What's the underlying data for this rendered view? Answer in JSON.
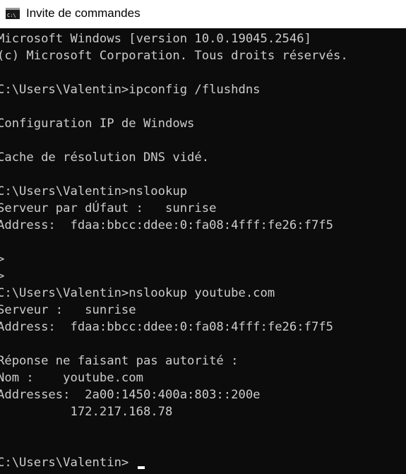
{
  "window": {
    "title": "Invite de commandes",
    "icon": "cmd-icon",
    "icon_label": "C:\\"
  },
  "console": {
    "lines": [
      "Microsoft Windows [version 10.0.19045.2546]",
      "(c) Microsoft Corporation. Tous droits réservés.",
      "",
      "C:\\Users\\Valentin>ipconfig /flushdns",
      "",
      "Configuration IP de Windows",
      "",
      "Cache de résolution DNS vidé.",
      "",
      "C:\\Users\\Valentin>nslookup",
      "Serveur par dÚfaut :   sunrise",
      "Address:  fdaa:bbcc:ddee:0:fa08:4fff:fe26:f7f5",
      "",
      ">",
      ">",
      "C:\\Users\\Valentin>nslookup youtube.com",
      "Serveur :   sunrise",
      "Address:  fdaa:bbcc:ddee:0:fa08:4fff:fe26:f7f5",
      "",
      "Réponse ne faisant pas autorité :",
      "Nom :    youtube.com",
      "Addresses:  2a00:1450:400a:803::200e",
      "          172.217.168.78",
      "",
      "",
      "C:\\Users\\Valentin>"
    ]
  },
  "colors": {
    "background": "#0c0c0c",
    "text": "#cccccc",
    "titlebar": "#ffffff",
    "cursor": "#ffffff"
  }
}
